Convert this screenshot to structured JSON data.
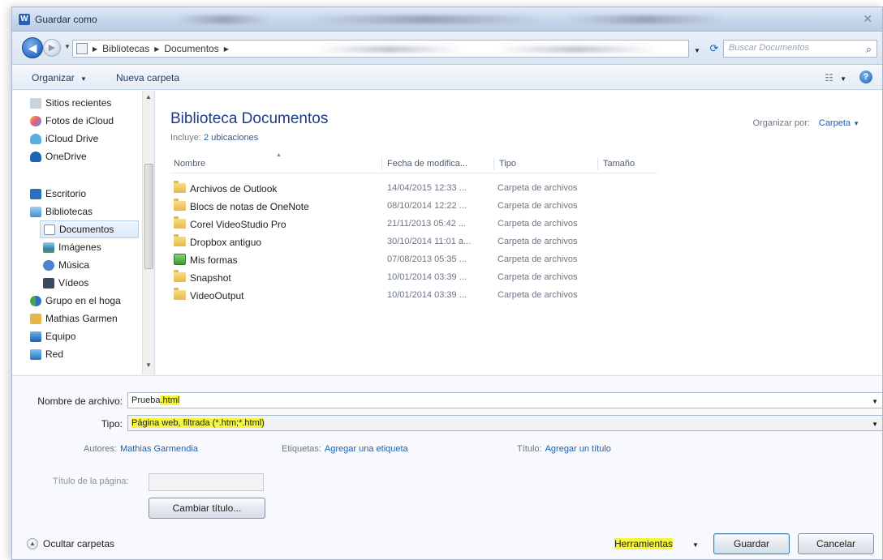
{
  "window": {
    "title": "Guardar como"
  },
  "address": {
    "crumbs": [
      "Bibliotecas",
      "Documentos"
    ],
    "search_placeholder": "Buscar Documentos"
  },
  "toolbar": {
    "organize": "Organizar",
    "new_folder": "Nueva carpeta"
  },
  "nav": {
    "items": [
      {
        "label": "Sitios recientes",
        "icon": "recent-places-icon"
      },
      {
        "label": "Fotos de iCloud",
        "icon": "icloud-photos-icon"
      },
      {
        "label": "iCloud Drive",
        "icon": "icloud-drive-icon"
      },
      {
        "label": "OneDrive",
        "icon": "onedrive-icon"
      },
      {
        "label": "Escritorio",
        "icon": "desktop-icon"
      },
      {
        "label": "Bibliotecas",
        "icon": "libraries-icon"
      },
      {
        "label": "Documentos",
        "icon": "documents-icon"
      },
      {
        "label": "Imágenes",
        "icon": "pictures-icon"
      },
      {
        "label": "Música",
        "icon": "music-icon"
      },
      {
        "label": "Vídeos",
        "icon": "videos-icon"
      },
      {
        "label": "Grupo en el hoga",
        "icon": "homegroup-icon"
      },
      {
        "label": "Mathias Garmen",
        "icon": "user-icon"
      },
      {
        "label": "Equipo",
        "icon": "computer-icon"
      },
      {
        "label": "Red",
        "icon": "network-icon"
      }
    ]
  },
  "library": {
    "title": "Biblioteca Documentos",
    "includes_label": "Incluye:",
    "includes_link": "2 ubicaciones",
    "arrange_label": "Organizar por:",
    "arrange_value": "Carpeta"
  },
  "columns": {
    "name": "Nombre",
    "date": "Fecha de modifica...",
    "type": "Tipo",
    "size": "Tamaño"
  },
  "files": [
    {
      "name": "Archivos de Outlook",
      "date": "14/04/2015 12:33 ...",
      "type": "Carpeta de archivos",
      "icon": "folder-icon"
    },
    {
      "name": "Blocs de notas de OneNote",
      "date": "08/10/2014 12:22 ...",
      "type": "Carpeta de archivos",
      "icon": "folder-icon"
    },
    {
      "name": "Corel VideoStudio Pro",
      "date": "21/11/2013 05:42 ...",
      "type": "Carpeta de archivos",
      "icon": "folder-icon"
    },
    {
      "name": "Dropbox antiguo",
      "date": "30/10/2014 11:01 a...",
      "type": "Carpeta de archivos",
      "icon": "folder-icon"
    },
    {
      "name": "Mis formas",
      "date": "07/08/2013 05:35 ...",
      "type": "Carpeta de archivos",
      "icon": "forms-folder-icon"
    },
    {
      "name": "Snapshot",
      "date": "10/01/2014 03:39 ...",
      "type": "Carpeta de archivos",
      "icon": "folder-icon"
    },
    {
      "name": "VideoOutput",
      "date": "10/01/2014 03:39 ...",
      "type": "Carpeta de archivos",
      "icon": "folder-icon"
    }
  ],
  "form": {
    "filename_label": "Nombre de archivo:",
    "filename_base": "Prueba",
    "filename_ext": ".html",
    "type_label": "Tipo:",
    "type_value": "Página web, filtrada (*.htm;*.html)",
    "authors_label": "Autores:",
    "authors_value": "Mathias Garmendia",
    "tags_label": "Etiquetas:",
    "tags_value": "Agregar una etiqueta",
    "title_label": "Título:",
    "title_value": "Agregar un título",
    "page_title_label": "Título de la página:",
    "change_title": "Cambiar título..."
  },
  "footer": {
    "hide_folders": "Ocultar carpetas",
    "tools": "Herramientas",
    "save": "Guardar",
    "cancel": "Cancelar"
  },
  "colors": {
    "highlight": "#f6f640",
    "link": "#1f5fb0",
    "title_blue": "#1e3a8a"
  }
}
